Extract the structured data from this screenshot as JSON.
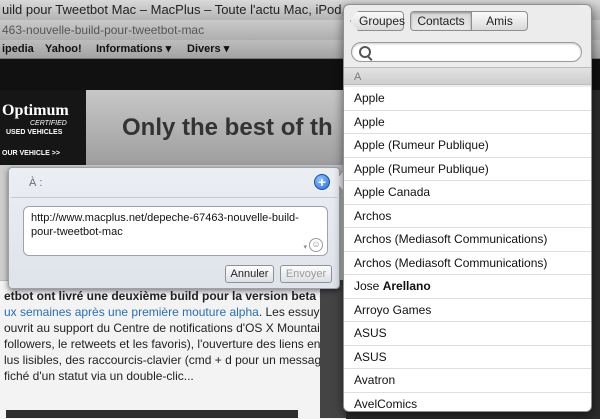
{
  "browser": {
    "title": "uild pour Tweetbot Mac – MacPlus – Toute l'actu Mac, iPod, iPad, iPhone",
    "url": "463-nouvelle-build-pour-tweetbot-mac",
    "bookmarks": [
      "ipedia",
      "Yahoo!",
      "Informations ▾",
      "Divers ▾"
    ]
  },
  "ad": {
    "brand": "Optimum",
    "certified": "CERTIFIED",
    "used": "USED VEHICLES",
    "cta": "OUR VEHICLE >>",
    "headline": "Only the best of th"
  },
  "article": {
    "lines": [
      "etbot ont livré une deuxième build pour la version beta du",
      "ux semaines après une première mouture alpha",
      ". Les essuyeurs",
      "ouvrit au support du Centre de notifications d'OS X Mountain",
      "followers, le retweets et les favoris), l'ouverture des liens en",
      "lus lisibles, des raccourcis-clavier (cmd + d pour un message",
      "fiché d'un statut via un double-clic..."
    ]
  },
  "compose": {
    "to_label": "À :",
    "message": "http://www.macplus.net/depeche-67463-nouvelle-build-pour-tweetbot-mac",
    "cancel_label": "Annuler",
    "send_label": "Envoyer"
  },
  "contacts": {
    "back_label": "Groupes",
    "tabs": [
      "Contacts",
      "Amis"
    ],
    "selected_tab": "Contacts",
    "search_placeholder": "",
    "section": "A",
    "items": [
      {
        "first": "Apple",
        "last": ""
      },
      {
        "first": "Apple",
        "last": ""
      },
      {
        "first": "Apple (Rumeur Publique)",
        "last": ""
      },
      {
        "first": "Apple (Rumeur Publique)",
        "last": ""
      },
      {
        "first": "Apple Canada",
        "last": ""
      },
      {
        "first": "Archos",
        "last": ""
      },
      {
        "first": "Archos (Mediasoft Communications)",
        "last": ""
      },
      {
        "first": "Archos (Mediasoft Communications)",
        "last": ""
      },
      {
        "first": "Jose",
        "last": "Arellano"
      },
      {
        "first": "Arroyo Games",
        "last": ""
      },
      {
        "first": "ASUS",
        "last": ""
      },
      {
        "first": "ASUS",
        "last": ""
      },
      {
        "first": "Avatron",
        "last": ""
      },
      {
        "first": "AvelComics",
        "last": ""
      }
    ]
  },
  "colors": {
    "accent": "#2a6fd6",
    "link": "#2b6db5"
  }
}
